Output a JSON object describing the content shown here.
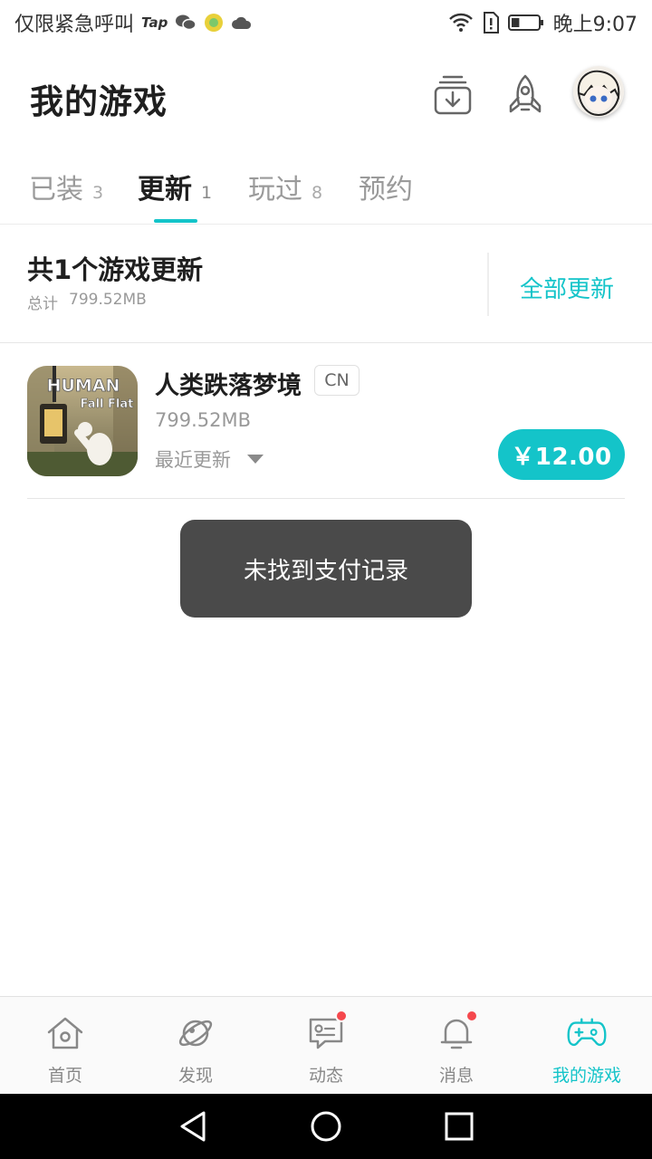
{
  "status_bar": {
    "carrier": "仅限紧急呼叫",
    "tap_label": "Tap",
    "time": "晚上9:07",
    "battery_level": 0.3
  },
  "header": {
    "title": "我的游戏"
  },
  "tabs": [
    {
      "label": "已装",
      "count": "3"
    },
    {
      "label": "更新",
      "count": "1"
    },
    {
      "label": "玩过",
      "count": "8"
    },
    {
      "label": "预约",
      "count": ""
    }
  ],
  "active_tab": "更新",
  "summary": {
    "title": "共1个游戏更新",
    "total_label": "总计",
    "total_size": "799.52MB",
    "update_all_label": "全部更新"
  },
  "game": {
    "name": "人类跌落梦境",
    "region": "CN",
    "size": "799.52MB",
    "recent_update_label": "最近更新",
    "price": "￥12.00",
    "icon_text_top": "HUMAN",
    "icon_text_bottom": "Fall Flat"
  },
  "toast": {
    "message": "未找到支付记录"
  },
  "bottom_nav": [
    {
      "label": "首页",
      "icon": "home-icon"
    },
    {
      "label": "发现",
      "icon": "planet-icon"
    },
    {
      "label": "动态",
      "icon": "chat-icon"
    },
    {
      "label": "消息",
      "icon": "bell-icon"
    },
    {
      "label": "我的游戏",
      "icon": "gamepad-icon"
    }
  ],
  "colors": {
    "accent": "#14c4c9",
    "badge": "#f5484d",
    "toast_bg": "#4a4a4a"
  }
}
